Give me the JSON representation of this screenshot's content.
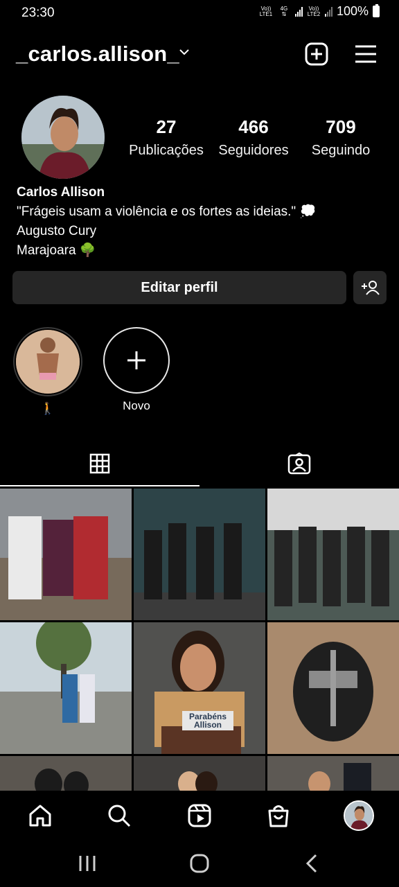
{
  "status_bar": {
    "time": "23:30",
    "sim1_label_top": "Vo))",
    "sim1_label_bottom": "LTE1",
    "network": "4G",
    "sim2_label_top": "Vo))",
    "sim2_label_bottom": "LTE2",
    "battery": "100%"
  },
  "header": {
    "username": "_carlos.allison_",
    "icons": [
      "chevron-down-icon",
      "new-post-icon",
      "menu-icon"
    ]
  },
  "profile": {
    "stats": [
      {
        "value": "27",
        "label": "Publicações"
      },
      {
        "value": "466",
        "label": "Seguidores"
      },
      {
        "value": "709",
        "label": "Seguindo"
      }
    ],
    "name": "Carlos Allison",
    "bio_line1": "\"Frágeis  usam a  violência e os fortes as ideias.\" 💭",
    "bio_line2": "Augusto Cury",
    "bio_line3": "Marajoara 🌳"
  },
  "actions": {
    "edit_profile": "Editar perfil",
    "suggest_icon": "add-person-icon"
  },
  "highlights": [
    {
      "label": "🚶"
    },
    {
      "label": "Novo"
    }
  ],
  "tabs": [
    {
      "name": "grid",
      "icon": "grid-icon",
      "active": true
    },
    {
      "name": "tagged",
      "icon": "tagged-icon",
      "active": false
    }
  ],
  "bottom_nav": [
    "home-icon",
    "search-icon",
    "reels-icon",
    "shop-icon",
    "profile-avatar"
  ],
  "system_nav": [
    "recents-icon",
    "home-button-icon",
    "back-icon"
  ],
  "grid_posts": [
    {
      "caption": "",
      "overlay": ""
    },
    {
      "caption": "",
      "overlay": ""
    },
    {
      "caption": "",
      "overlay": ""
    },
    {
      "caption": "",
      "overlay": ""
    },
    {
      "caption": "",
      "overlay": "Parabéns Allison"
    },
    {
      "caption": "",
      "overlay": ""
    }
  ]
}
